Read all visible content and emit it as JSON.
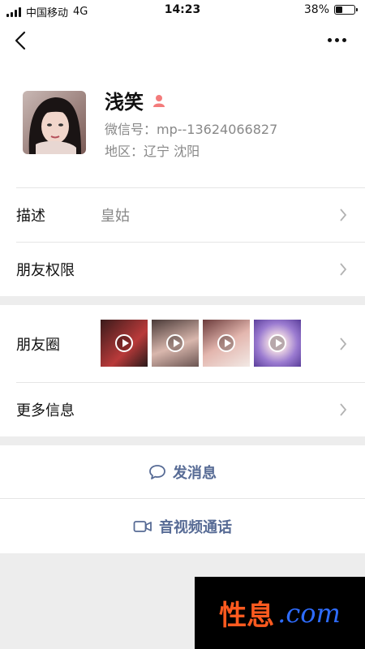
{
  "status_bar": {
    "carrier": "中国移动",
    "network": "4G",
    "time": "14:23",
    "battery_percent": "38%",
    "battery_level": 0.38
  },
  "nav": {
    "back_icon": "chevron-left-icon",
    "more_icon": "more-dots-icon"
  },
  "profile": {
    "name": "浅笑",
    "gender_icon": "female-person-icon",
    "gender_color": "#f37b7b",
    "wechat_id": "微信号：mp--13624066827",
    "region": "地区：辽宁 沈阳"
  },
  "rows": {
    "description_label": "描述",
    "description_value": "皇姑",
    "permissions_label": "朋友权限",
    "moments_label": "朋友圈",
    "more_info_label": "更多信息"
  },
  "actions": {
    "message_label": "发消息",
    "video_call_label": "音视频通话",
    "link_color": "#576b95"
  },
  "watermark": {
    "top_text": ".com",
    "brand_cn": "性息",
    "brand_en": ".com"
  }
}
